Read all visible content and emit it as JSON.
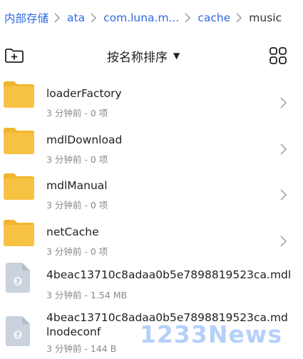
{
  "breadcrumb": {
    "items": [
      "内部存储",
      "ata",
      "com.luna.m...",
      "cache",
      "music"
    ]
  },
  "toolbar": {
    "new_folder_icon": "folder-add-icon",
    "sort_label": "按名称排序",
    "sort_caret": "▼",
    "view_icon": "grid-view-icon"
  },
  "items": [
    {
      "type": "folder",
      "name": "loaderFactory",
      "meta": "3 分钟前 - 0 项"
    },
    {
      "type": "folder",
      "name": "mdlDownload",
      "meta": "3 分钟前 - 0 项"
    },
    {
      "type": "folder",
      "name": "mdlManual",
      "meta": "3 分钟前 - 0 项"
    },
    {
      "type": "folder",
      "name": "netCache",
      "meta": "3 分钟前 - 0 项"
    },
    {
      "type": "file",
      "name": "4beac13710c8adaa0b5e7898819523ca.mdl",
      "meta": "3 分钟前 - 1.54 MB"
    },
    {
      "type": "file",
      "name": "4beac13710c8adaa0b5e7898819523ca.mdlnodeconf",
      "meta": "3 分钟前 - 144 B"
    }
  ],
  "watermark": {
    "text": "1233News"
  },
  "colors": {
    "accent": "#2f6ae1",
    "folder": "#f7c244",
    "folder_tab": "#f0b62f",
    "file_icon": "#c9d2dd",
    "meta_text": "#8a8a8a"
  }
}
